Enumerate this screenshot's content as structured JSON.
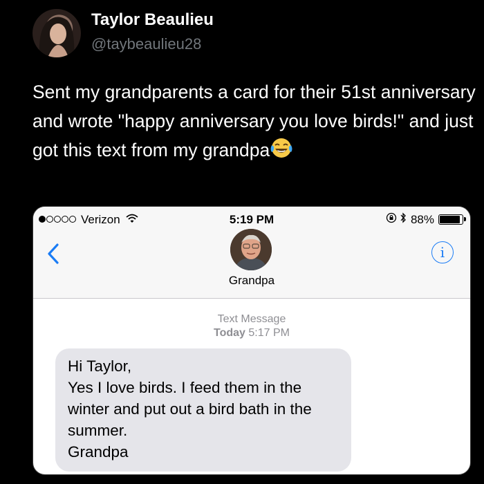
{
  "tweet": {
    "author_name": "Taylor Beaulieu",
    "author_handle": "@taybeaulieu28",
    "text": "Sent my grandparents a card for their 51st anniversary and wrote \"happy anniversary you love birds!\" and just got this text from my grandpa",
    "emoji": "face-with-tears-of-joy"
  },
  "phone": {
    "status_bar": {
      "carrier": "Verizon",
      "time": "5:19 PM",
      "battery": "88%",
      "battery_level": 0.88
    },
    "contact": {
      "name": "Grandpa"
    },
    "thread": {
      "label": "Text Message",
      "date": "Today",
      "time": "5:17 PM"
    },
    "message": {
      "lines": [
        "Hi Taylor,",
        "Yes I love birds. I feed them in the",
        "winter and put out a bird bath in the",
        "summer.",
        "Grandpa"
      ]
    }
  },
  "colors": {
    "background": "#000000",
    "handle": "#71767b",
    "ios_blue": "#1a7cf5",
    "bubble": "#e5e5ea"
  }
}
